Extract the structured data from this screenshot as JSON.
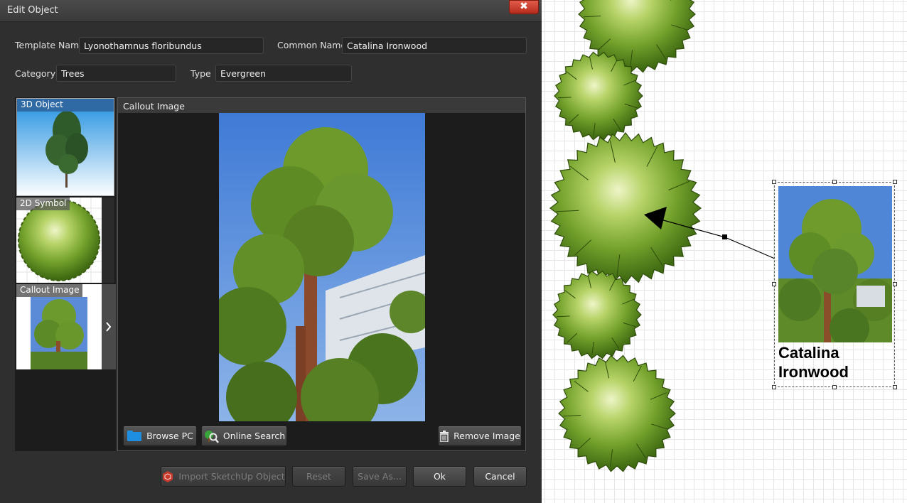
{
  "dialog": {
    "title": "Edit Object",
    "close_glyph": "✖"
  },
  "form": {
    "template_name_label": "Template Name",
    "template_name_value": "Lyonothamnus floribundus",
    "common_name_label": "Common Name",
    "common_name_value": "Catalina Ironwood",
    "category_label": "Category",
    "category_value": "Trees",
    "type_label": "Type",
    "type_value": "Evergreen"
  },
  "tabs": [
    {
      "label": "3D Object",
      "selected": true
    },
    {
      "label": "2D Symbol",
      "selected": false
    },
    {
      "label": "Callout Image",
      "selected": false
    }
  ],
  "tabs_expand_icon": "chevron-right-icon",
  "preview": {
    "title": "Callout Image",
    "browse_label": "Browse PC",
    "online_search_label": "Online Search",
    "remove_label": "Remove Image"
  },
  "footer": {
    "import_label": "Import SketchUp Object",
    "reset_label": "Reset",
    "save_as_label": "Save As...",
    "ok_label": "Ok",
    "cancel_label": "Cancel"
  },
  "canvas": {
    "callout_label_line1": "Catalina",
    "callout_label_line2": "Ironwood"
  },
  "colors": {
    "dialog_bg": "#2f2f2f",
    "selected_tab": "#2f6aa5",
    "close_button": "#c9412f",
    "tree_green": "#5f8f1f"
  }
}
